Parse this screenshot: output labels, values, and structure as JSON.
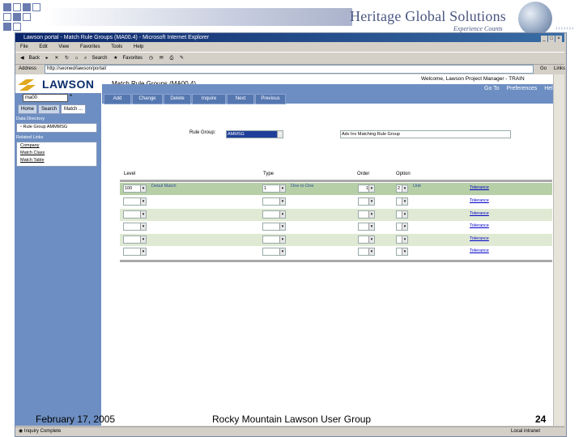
{
  "slide": {
    "brand": "Heritage Global Solutions",
    "tagline": "Experience Counts",
    "footer_date": "February 17, 2005",
    "footer_group": "Rocky Mountain Lawson User Group",
    "page_number": "24"
  },
  "browser": {
    "title": "Lawson portal - Match Rule Groups (MA00.4) - Microsoft Internet Explorer",
    "menu": [
      "File",
      "Edit",
      "View",
      "Favorites",
      "Tools",
      "Help"
    ],
    "toolbar": [
      "Back",
      "Search",
      "Favorites"
    ],
    "address_label": "Address",
    "address_value": "http://seoned/lawson/portal/",
    "go_label": "Go",
    "links_label": "Links",
    "status_left": "Inquiry Complete",
    "status_right": "Local intranet"
  },
  "app": {
    "logo": "LAWSON",
    "form_title": "Match Rule Groups (MA00.4)",
    "welcome": "Welcome, Lawson Project Manager - TRAIN",
    "nav_links": [
      "Go To",
      "Preferences",
      "Help"
    ],
    "actions": [
      "Add",
      "Change",
      "Delete",
      "Inquire",
      "Next",
      "Previous"
    ],
    "sidebar": {
      "search_value": "ma00",
      "star": "*",
      "tabs": [
        "Home",
        "Search",
        "Match ..."
      ],
      "data_directory_label": "Data Directory",
      "data_directory_items": [
        "Rule Group AMMMSG"
      ],
      "related_links_label": "Related Links",
      "related_links": [
        "Company",
        "Match Class",
        "Match Table"
      ]
    },
    "form": {
      "rule_group_label": "Rule Group:",
      "rule_group_value": "AMMSG",
      "rule_group_desc": "Adv Inv Matching Rule Group",
      "columns": [
        "Level",
        "Type",
        "Order",
        "Option"
      ],
      "rows": [
        {
          "level": "100",
          "level_desc": "Detail Match",
          "type": "1",
          "type_desc": "One to One",
          "order": "1",
          "option": "2",
          "option_desc": "Unit",
          "link": "Tolerance"
        },
        {
          "level": "",
          "level_desc": "",
          "type": "",
          "type_desc": "",
          "order": "",
          "option": "",
          "option_desc": "",
          "link": "Tolerance"
        },
        {
          "level": "",
          "level_desc": "",
          "type": "",
          "type_desc": "",
          "order": "",
          "option": "",
          "option_desc": "",
          "link": "Tolerance"
        },
        {
          "level": "",
          "level_desc": "",
          "type": "",
          "type_desc": "",
          "order": "",
          "option": "",
          "option_desc": "",
          "link": "Tolerance"
        },
        {
          "level": "",
          "level_desc": "",
          "type": "",
          "type_desc": "",
          "order": "",
          "option": "",
          "option_desc": "",
          "link": "Tolerance"
        },
        {
          "level": "",
          "level_desc": "",
          "type": "",
          "type_desc": "",
          "order": "",
          "option": "",
          "option_desc": "",
          "link": "Tolerance"
        }
      ]
    }
  }
}
